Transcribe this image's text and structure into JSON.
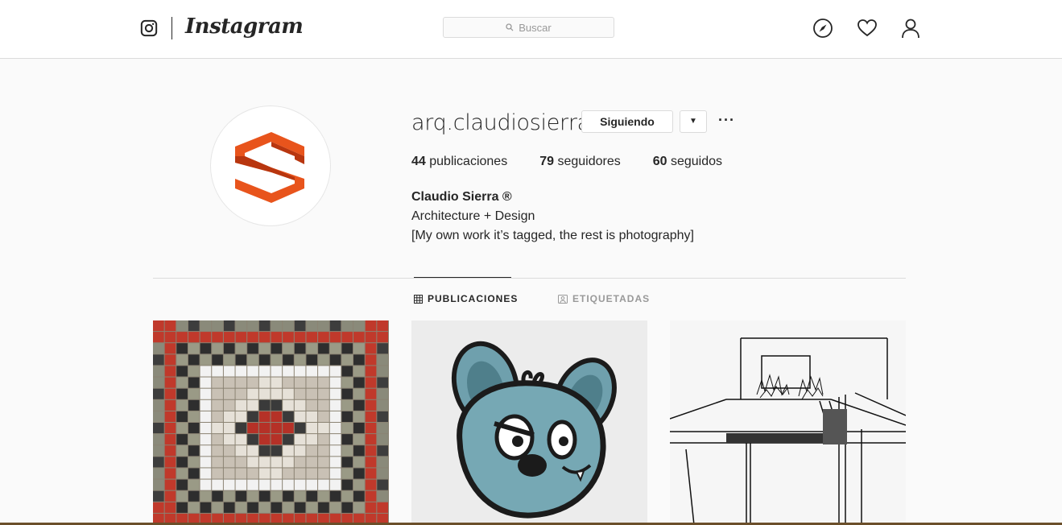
{
  "nav": {
    "brand": "Instagram",
    "search_placeholder": "Buscar"
  },
  "profile": {
    "username": "arq.claudiosierra",
    "following_button": "Siguiendo",
    "more_button": "···",
    "stats": [
      {
        "count": "44",
        "label": "publicaciones"
      },
      {
        "count": "79",
        "label": "seguidores"
      },
      {
        "count": "60",
        "label": "seguidos"
      }
    ],
    "full_name": "Claudio Sierra ®",
    "bio_line1": "Architecture + Design",
    "bio_line2": "[My own work it’s tagged, the rest is photography]"
  },
  "tabs": [
    {
      "label": "PUBLICACIONES",
      "active": true
    },
    {
      "label": "ETIQUETADAS",
      "active": false
    }
  ],
  "colors": {
    "logo_orange": "#e8541c",
    "logo_dark_orange": "#b8360f"
  },
  "posts": [
    {
      "subject": "mosaic-tile-floor"
    },
    {
      "subject": "blue-cartoon-mouse"
    },
    {
      "subject": "architectural-sketch"
    }
  ]
}
